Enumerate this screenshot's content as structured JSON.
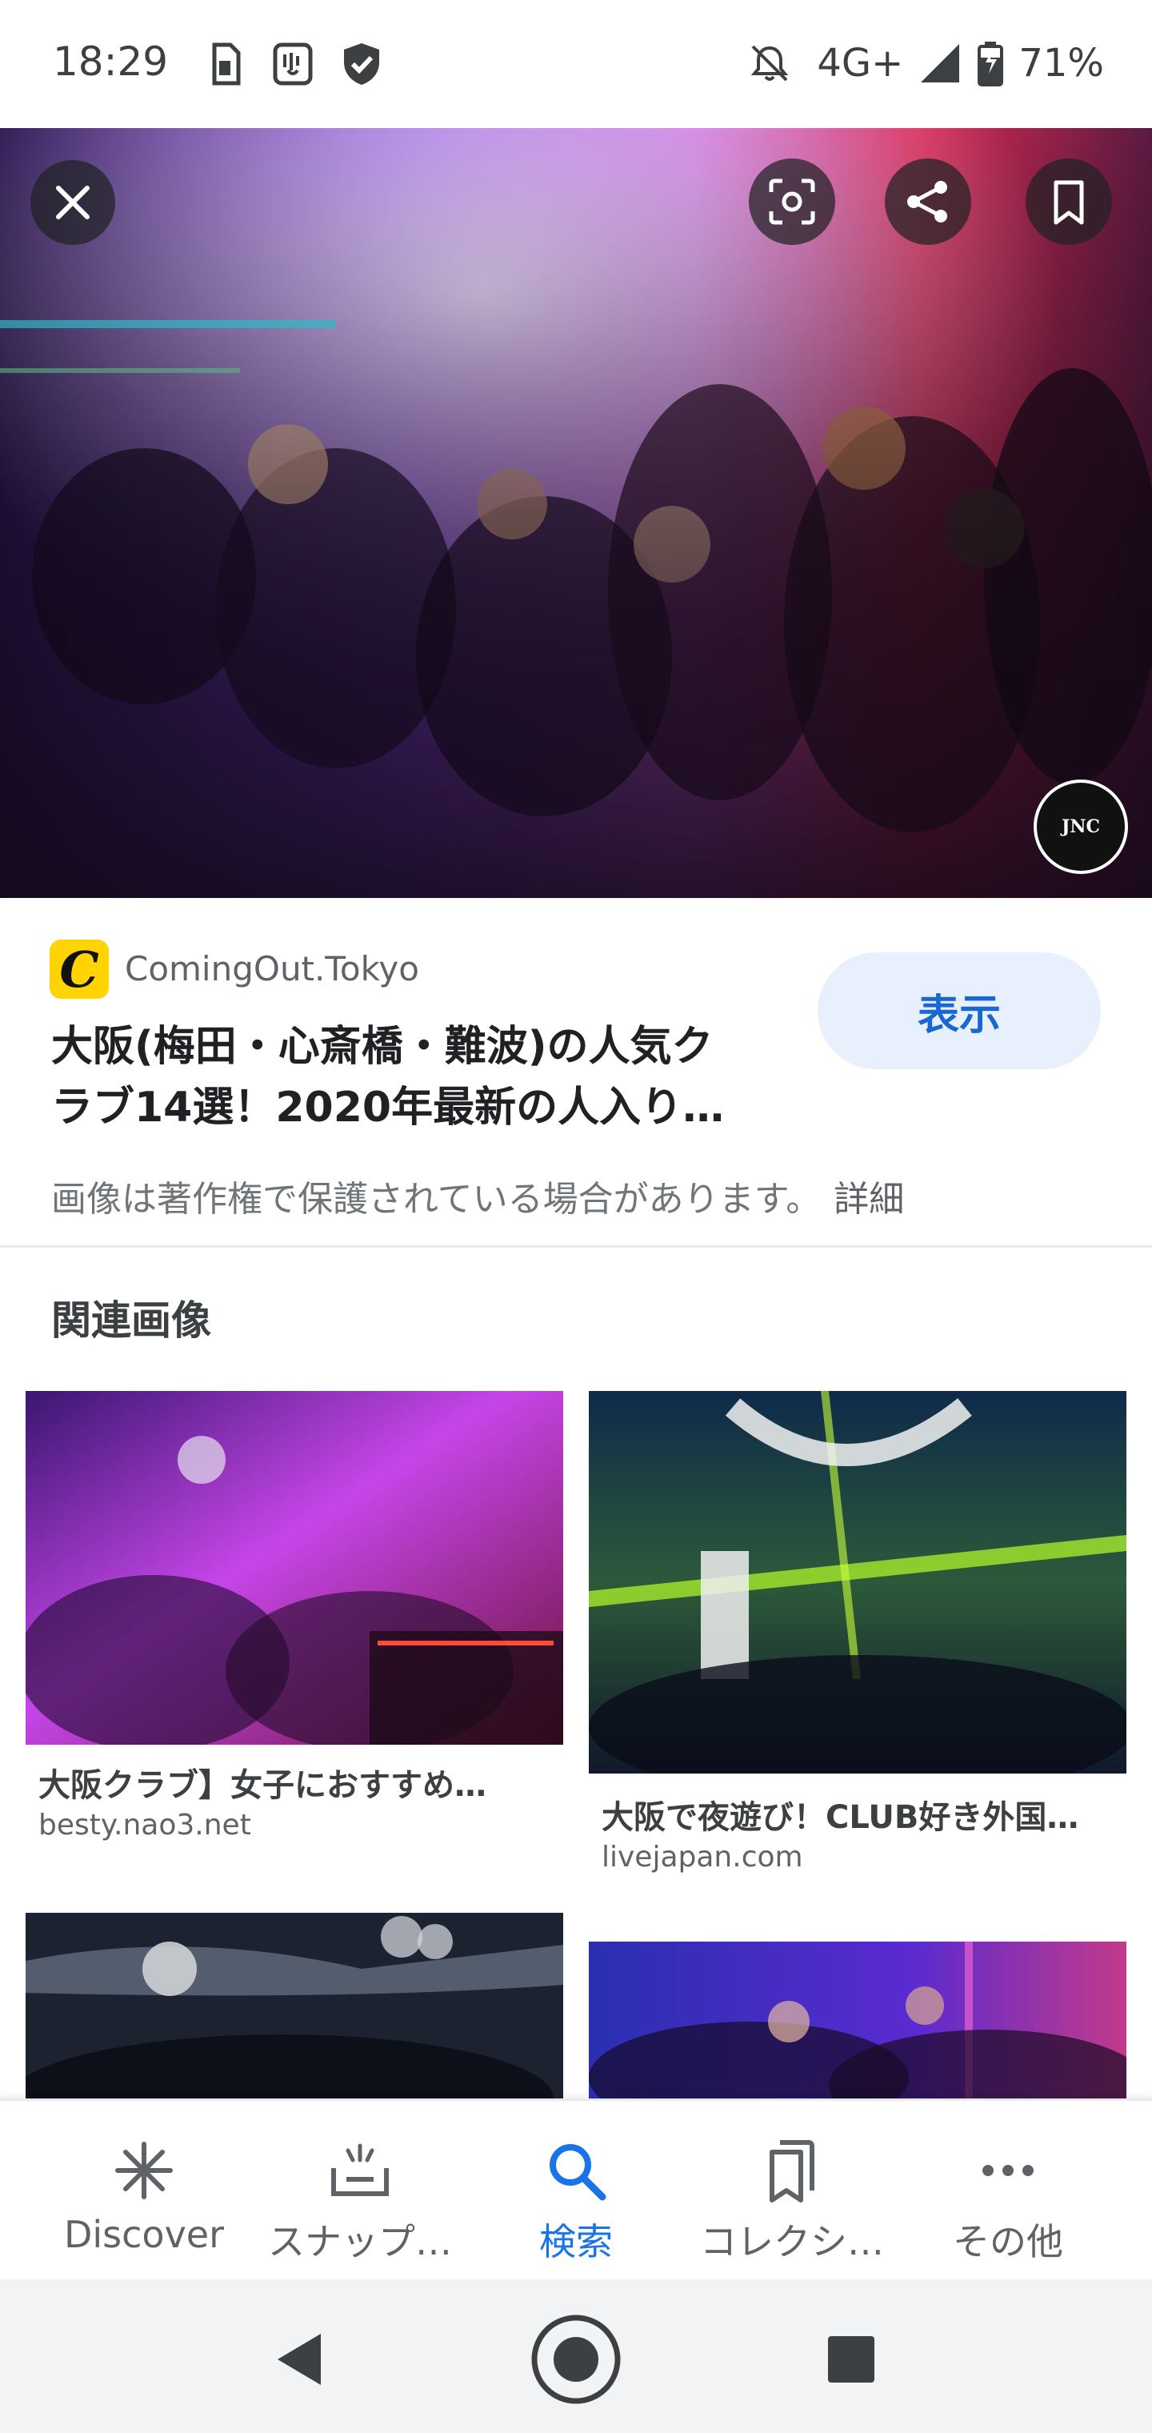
{
  "status_bar": {
    "time": "18:29",
    "network": "4G+",
    "battery": "71%",
    "left_icons": [
      "sim-card-icon",
      "vibrate-app-icon",
      "shield-check-icon"
    ],
    "right_icons": [
      "notifications-off-icon",
      "signal-icon",
      "battery-charging-icon"
    ]
  },
  "hero": {
    "close_icon": "close-icon",
    "actions": [
      "lens-icon",
      "share-icon",
      "bookmark-icon"
    ],
    "watermark_text": "JNC"
  },
  "source": {
    "logo_letter": "C",
    "site_name": "ComingOut.Tokyo",
    "title_line1": "大阪(梅田・心斎橋・難波)の人気ク",
    "title_line2": "ラブ14選！2020年最新の人入り…",
    "view_button": "表示",
    "copyright_text": "画像は著作権で保護されている場合があります。",
    "detail_link": "詳細"
  },
  "related": {
    "heading": "関連画像",
    "items": [
      {
        "title": "大阪クラブ】女子におすすめ…",
        "domain": "besty.nao3.net"
      },
      {
        "title": "大阪で夜遊び！CLUB好き外国…",
        "domain": "livejapan.com"
      },
      {
        "title": "",
        "domain": ""
      },
      {
        "title": "",
        "domain": ""
      }
    ]
  },
  "bottom_nav": {
    "items": [
      {
        "label": "Discover",
        "icon": "asterisk-icon",
        "active": false
      },
      {
        "label": "スナップ…",
        "icon": "snapshot-icon",
        "active": false
      },
      {
        "label": "検索",
        "icon": "search-icon",
        "active": true
      },
      {
        "label": "コレクシ…",
        "icon": "collections-icon",
        "active": false
      },
      {
        "label": "その他",
        "icon": "more-horiz-icon",
        "active": false
      }
    ]
  },
  "colors": {
    "accent": "#1a73e8",
    "button_bg": "#e8f0fe",
    "button_text": "#1967d2",
    "text_primary": "#202124",
    "text_secondary": "#5f6368"
  }
}
